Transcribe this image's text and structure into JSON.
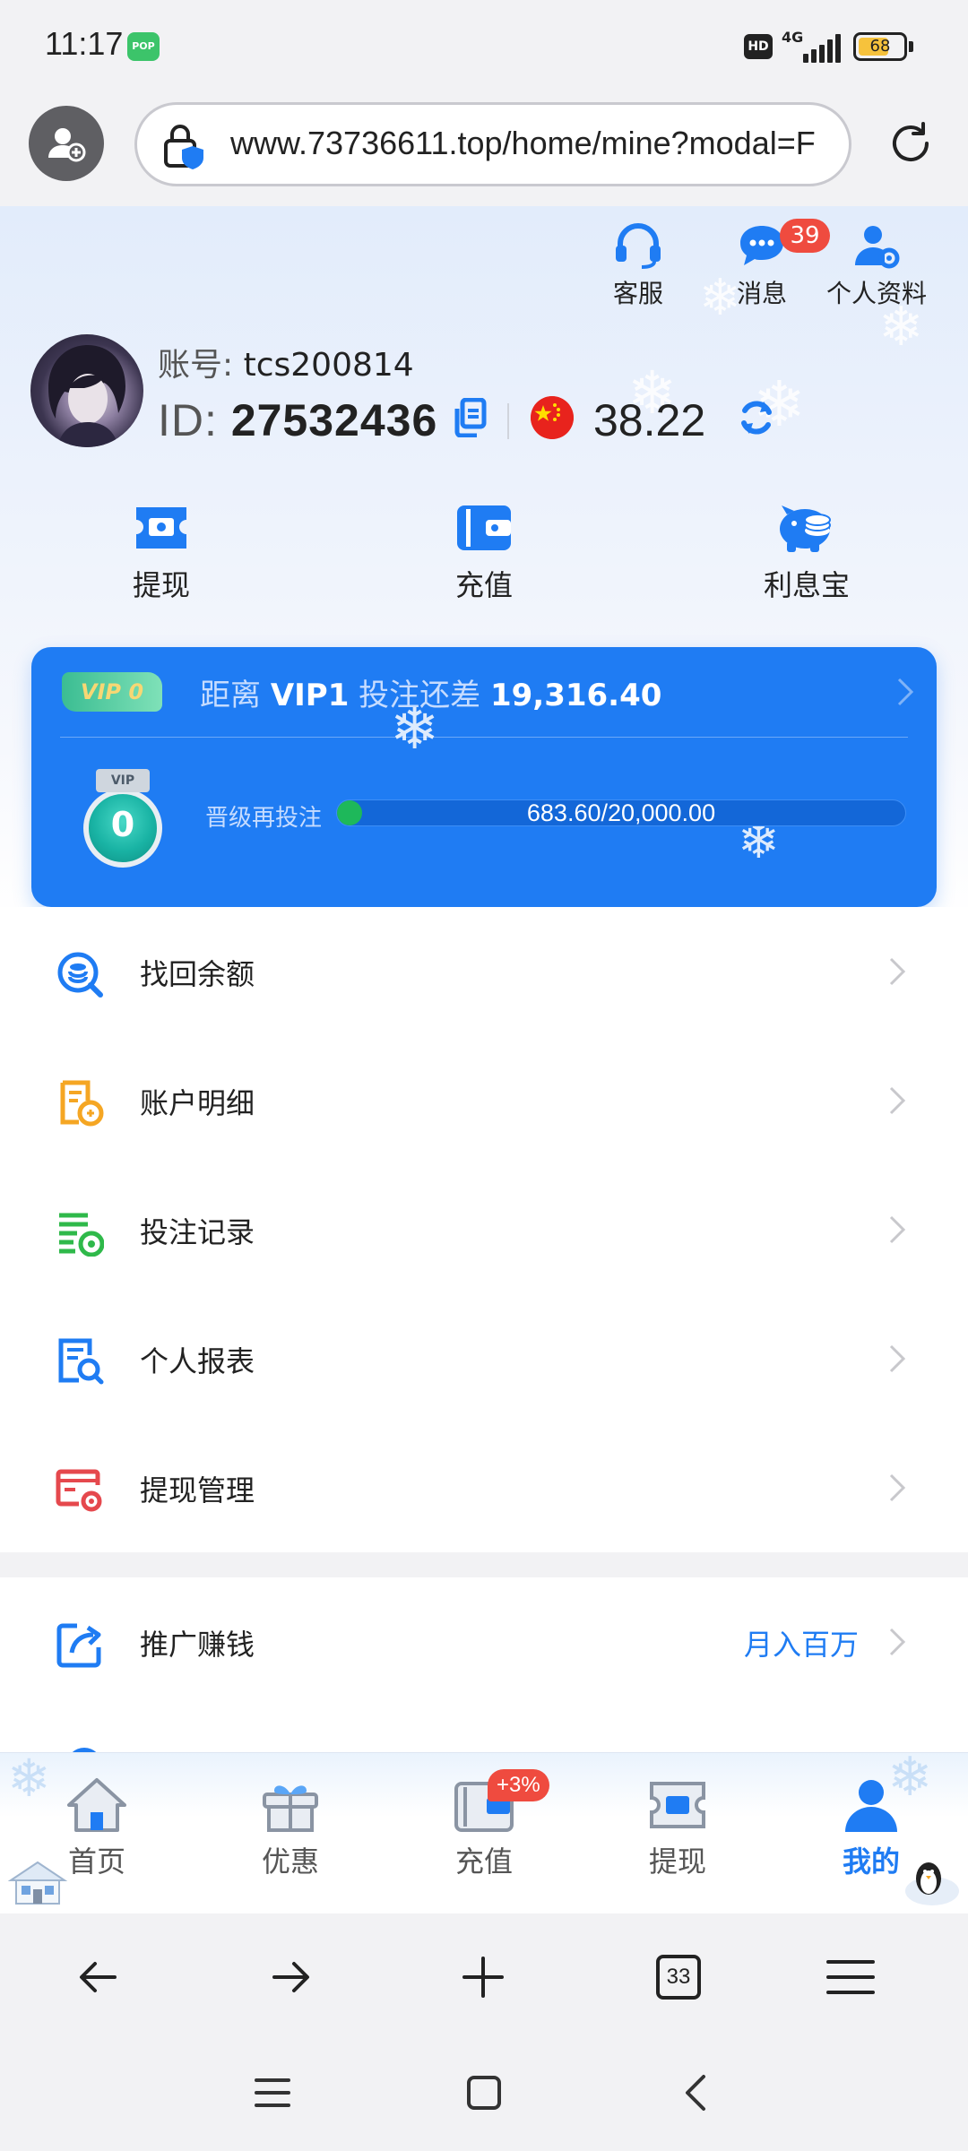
{
  "status_bar": {
    "time": "11:17",
    "notification_app": "POP",
    "hd_label": "HD",
    "network": "4G",
    "battery": "68",
    "battery_level": 0.68
  },
  "browser": {
    "url": "www.73736611.top/home/mine?modal=F"
  },
  "header": {
    "support_label": "客服",
    "messages_label": "消息",
    "messages_badge": "39",
    "profile_label": "个人资料"
  },
  "account": {
    "account_label": "账号:",
    "account_name": "tcs200814",
    "id_label": "ID:",
    "id_value": "27532436",
    "balance": "38.22"
  },
  "quick_actions": [
    {
      "label": "提现",
      "icon": "withdraw-icon"
    },
    {
      "label": "充值",
      "icon": "wallet-icon"
    },
    {
      "label": "利息宝",
      "icon": "piggy-bank-icon"
    }
  ],
  "vip": {
    "badge": "VIP 0",
    "distance_label": "距离",
    "next_level": "VIP1",
    "bet_gap_label": "投注还差",
    "bet_gap_value": "19,316.40",
    "medal_ribbon": "VIP",
    "medal_level": "0",
    "progress_label": "晋级再投注",
    "progress_text": "683.60/20,000.00",
    "progress_fraction": 0.03418
  },
  "menu": [
    {
      "label": "找回余额",
      "icon": "search-balance-icon"
    },
    {
      "label": "账户明细",
      "icon": "account-detail-icon"
    },
    {
      "label": "投注记录",
      "icon": "bet-record-icon"
    },
    {
      "label": "个人报表",
      "icon": "report-icon"
    },
    {
      "label": "提现管理",
      "icon": "withdraw-manage-icon"
    }
  ],
  "promo": {
    "label": "推广赚钱",
    "right_text": "月入百万"
  },
  "app_nav": {
    "items": [
      {
        "label": "首页",
        "icon": "home-icon"
      },
      {
        "label": "优惠",
        "icon": "gift-icon"
      },
      {
        "label": "充值",
        "icon": "wallet-icon"
      },
      {
        "label": "提现",
        "icon": "withdraw-icon"
      },
      {
        "label": "我的",
        "icon": "user-icon"
      }
    ],
    "recharge_badge": "+3%",
    "active": "我的"
  },
  "browser_nav": {
    "tab_count": "33"
  },
  "colors": {
    "accent": "#1f7cf3",
    "badge": "#ef4b3f",
    "progress": "#1eb85a"
  }
}
